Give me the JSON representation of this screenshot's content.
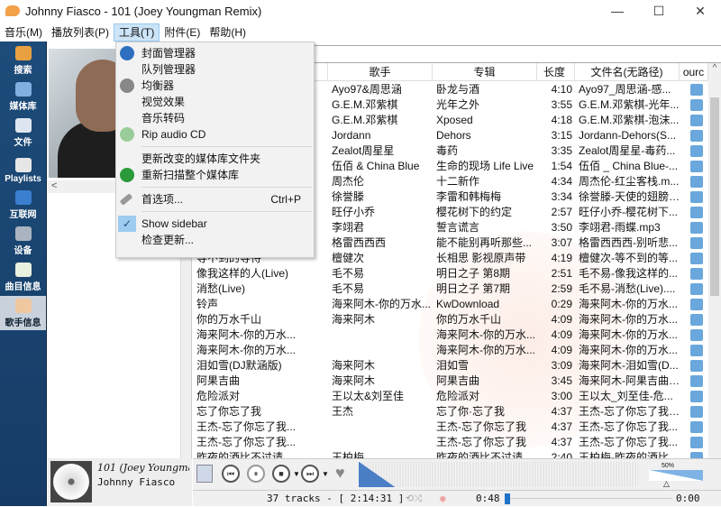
{
  "window": {
    "title": "Johnny Fiasco - 101 (Joey Youngman Remix)",
    "min": "—",
    "max": "☐",
    "close": "✕"
  },
  "menubar": [
    "音乐(M)",
    "播放列表(P)",
    "工具(T)",
    "附件(E)",
    "帮助(H)"
  ],
  "sidebar": [
    {
      "label": "搜索",
      "icon": "search-icon",
      "color": "#e8a040"
    },
    {
      "label": "媒体库",
      "icon": "folder-icon",
      "color": "#7fb0e0"
    },
    {
      "label": "文件",
      "icon": "file-icon",
      "color": "#dde6f0"
    },
    {
      "label": "Playlists",
      "icon": "playlist-icon",
      "color": "#e6e6e6"
    },
    {
      "label": "互联网",
      "icon": "globe-icon",
      "color": "#3a7fd0"
    },
    {
      "label": "设备",
      "icon": "device-icon",
      "color": "#aab4c0"
    },
    {
      "label": "曲目信息",
      "icon": "track-info-icon",
      "color": "#e8f0e0"
    },
    {
      "label": "歌手信息",
      "icon": "artist-info-icon",
      "color": "#f0c8a0"
    }
  ],
  "tools_menu": {
    "items": [
      {
        "label": "封面管理器",
        "icon": "globe-icon"
      },
      {
        "label": "队列管理器"
      },
      {
        "label": "均衡器",
        "icon": "equalizer-icon"
      },
      {
        "label": "视觉效果"
      },
      {
        "label": "音乐转码"
      },
      {
        "label": "Rip audio CD",
        "icon": "cd-icon"
      }
    ],
    "items2": [
      {
        "label": "更新改变的媒体库文件夹"
      },
      {
        "label": "重新扫描整个媒体库",
        "icon": "refresh-icon"
      }
    ],
    "prefs": {
      "label": "首选项...",
      "shortcut": "Ctrl+P"
    },
    "show_sidebar": {
      "label": "Show sidebar",
      "checked": true
    },
    "check_updates": {
      "label": "检查更新..."
    }
  },
  "left": {
    "scroll_left": "<"
  },
  "now_playing": {
    "title": "101 (Joey Youngman Remix)",
    "artist": "Johnny Fiasco"
  },
  "table": {
    "headers": [
      "",
      "歌手",
      "专辑",
      "长度",
      "文件名(无路径)",
      "ourc"
    ],
    "rows": [
      [
        "",
        "Ayo97&周思涵",
        "卧龙与酒",
        "4:10",
        "Ayo97_周思涵-感..."
      ],
      [
        "",
        "G.E.M.邓紫棋",
        "光年之外",
        "3:55",
        "G.E.M.邓紫棋-光年..."
      ],
      [
        "",
        "G.E.M.邓紫棋",
        "Xposed",
        "4:18",
        "G.E.M.邓紫棋-泡沫..."
      ],
      [
        "",
        "Jordann",
        "Dehors",
        "3:15",
        "Jordann-Dehors(S..."
      ],
      [
        "",
        "Zealot周星星",
        "毒药",
        "3:35",
        "Zealot周星星-毒药..."
      ],
      [
        "",
        "伍佰 & China Blue",
        "生命的现场 Life Live",
        "1:54",
        "伍佰 _ China Blue-..."
      ],
      [
        "",
        "周杰伦",
        "十二新作",
        "4:34",
        "周杰伦-红尘客栈.m..."
      ],
      [
        "",
        "徐誉滕",
        "李雷和韩梅梅",
        "3:34",
        "徐誉滕-天使的翅膀...."
      ],
      [
        "",
        "旺仔小乔",
        "樱花树下的约定",
        "2:57",
        "旺仔小乔-樱花树下..."
      ],
      [
        "",
        "李翊君",
        "誓言谎言",
        "3:50",
        "李翊君-雨蝶.mp3"
      ],
      [
        "",
        "格雷西西西",
        "能不能别再听那些...",
        "3:07",
        "格雷西西西-别听悲..."
      ],
      [
        "等不到的等待",
        "檀健次",
        "长相思 影视原声带",
        "4:19",
        "檀健次-等不到的等..."
      ],
      [
        "像我这样的人(Live)",
        "毛不易",
        "明日之子 第8期",
        "2:51",
        "毛不易-像我这样的..."
      ],
      [
        "消愁(Live)",
        "毛不易",
        "明日之子 第7期",
        "2:59",
        "毛不易-消愁(Live)...."
      ],
      [
        "铃声",
        "海来阿木-你的万水...",
        "KwDownload",
        "0:29",
        "海来阿木-你的万水..."
      ],
      [
        "你的万水千山",
        "海来阿木",
        "你的万水千山",
        "4:09",
        "海来阿木-你的万水..."
      ],
      [
        "海来阿木-你的万水...",
        "",
        "海来阿木-你的万水...",
        "4:09",
        "海来阿木-你的万水..."
      ],
      [
        "海来阿木-你的万水...",
        "",
        "海来阿木-你的万水...",
        "4:09",
        "海来阿木-你的万水..."
      ],
      [
        "泪如雪(DJ默涵版)",
        "海来阿木",
        "泪如雪",
        "3:09",
        "海来阿木-泪如雪(D..."
      ],
      [
        "阿果吉曲",
        "海来阿木",
        "阿果吉曲",
        "3:45",
        "海来阿木-阿果吉曲...."
      ],
      [
        "危险派对",
        "王以太&刘至佳",
        "危险派对",
        "3:00",
        "王以太_刘至佳-危..."
      ],
      [
        "忘了你忘了我",
        "王杰",
        "忘了你·忘了我",
        "4:37",
        "王杰-忘了你忘了我...."
      ],
      [
        "王杰-忘了你忘了我...",
        "",
        "王杰-忘了你忘了我",
        "4:37",
        "王杰-忘了你忘了我..."
      ],
      [
        "王杰-忘了你忘了我...",
        "",
        "王杰-忘了你忘了我",
        "4:37",
        "王杰-忘了你忘了我..."
      ],
      [
        "昨夜的酒比不过请...",
        "王柏梅",
        "昨夜的酒比不过请",
        "2:40",
        "王柏梅-昨夜的酒比..."
      ]
    ]
  },
  "player": {
    "volume_label": "50%",
    "volume": 0.5,
    "status": "37 tracks - [ 2:14:31 ]",
    "elapsed": "0:48",
    "remaining": "0:00",
    "progress": 0.01
  }
}
